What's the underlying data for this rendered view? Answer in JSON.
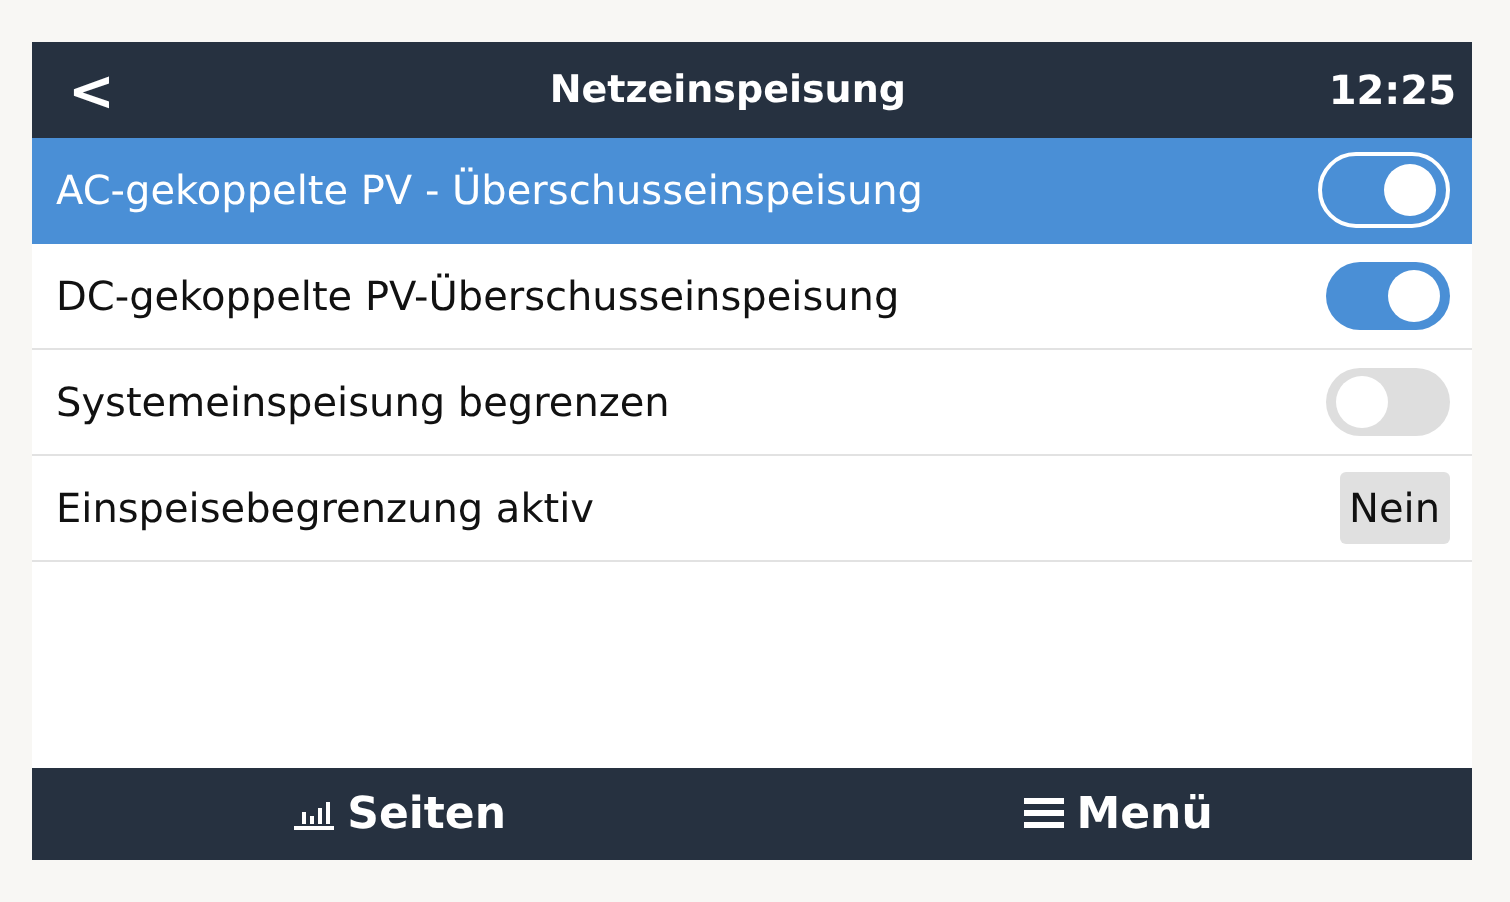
{
  "header": {
    "back": "<",
    "title": "Netzeinspeisung",
    "time": "12:25"
  },
  "rows": [
    {
      "kind": "switch",
      "label": "AC-gekoppelte PV - Überschusseinspeisung",
      "selected": true,
      "on": true
    },
    {
      "kind": "switch",
      "label": "DC-gekoppelte PV-Überschusseinspeisung",
      "selected": false,
      "on": true
    },
    {
      "kind": "switch",
      "label": "Systemeinspeisung begrenzen",
      "selected": false,
      "on": false
    },
    {
      "kind": "value",
      "label": "Einspeisebegrenzung aktiv",
      "selected": false,
      "value": "Nein"
    }
  ],
  "footer": {
    "pages": "Seiten",
    "menu": "Menü"
  }
}
